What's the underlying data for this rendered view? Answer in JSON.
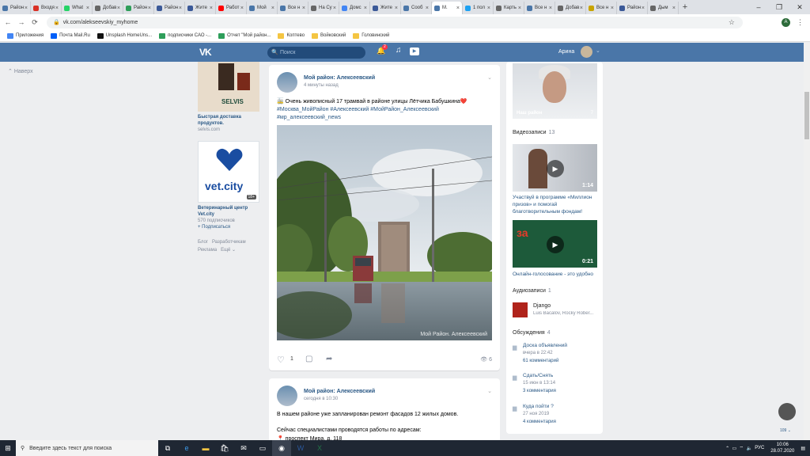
{
  "tabs": [
    {
      "label": "Район",
      "color": "#4a76a8"
    },
    {
      "label": "Входя",
      "color": "#d93025"
    },
    {
      "label": "What",
      "color": "#25d366"
    },
    {
      "label": "Добав",
      "color": "#666666"
    },
    {
      "label": "Район",
      "color": "#2e9e5a"
    },
    {
      "label": "Район",
      "color": "#3b5998"
    },
    {
      "label": "Жите",
      "color": "#3b5998"
    },
    {
      "label": "Работ",
      "color": "#ff0000"
    },
    {
      "label": "Мой",
      "color": "#4a76a8"
    },
    {
      "label": "Все н",
      "color": "#4a76a8"
    },
    {
      "label": "На Су",
      "color": "#666666"
    },
    {
      "label": "Домс",
      "color": "#4285f4"
    },
    {
      "label": "Жите",
      "color": "#3b5998"
    },
    {
      "label": "Сооб",
      "color": "#4a76a8"
    },
    {
      "label": "М.",
      "color": "#4a76a8",
      "active": true
    },
    {
      "label": "1 пол",
      "color": "#1da1f2"
    },
    {
      "label": "Карть",
      "color": "#666666"
    },
    {
      "label": "Все н",
      "color": "#4a76a8"
    },
    {
      "label": "Добав",
      "color": "#666666"
    },
    {
      "label": "Все н",
      "color": "#c8a400"
    },
    {
      "label": "Район",
      "color": "#3b5998"
    },
    {
      "label": "Дым",
      "color": "#666666"
    }
  ],
  "url": "vk.com/alekseevskiy_myhome",
  "profile_letter": "A",
  "bookmarks": [
    {
      "label": "Приложения",
      "color": "#4285f4"
    },
    {
      "label": "Почта Mail.Ru",
      "color": "#005ff9"
    },
    {
      "label": "Unsplash HomeUns...",
      "color": "#111111"
    },
    {
      "label": "подписчики САО -...",
      "color": "#2e9e5a"
    },
    {
      "label": "Отчет \"Мой район...",
      "color": "#2e9e5a"
    },
    {
      "label": "Коптево",
      "color": "#f4c542"
    },
    {
      "label": "Войковский",
      "color": "#f4c542"
    },
    {
      "label": "Головинский",
      "color": "#f4c542"
    }
  ],
  "vk": {
    "search_placeholder": "Поиск",
    "notif_count": "2",
    "user_name": "Арина"
  },
  "back_up": "Наверх",
  "left_ads": {
    "ad1_brand": "SELVIS",
    "ad1_title": "Быстрая доставка продуктов.",
    "ad1_site": "selvis.com",
    "ad2_brand": "vet.city",
    "ad2_age": "18+",
    "ad2_title": "Ветеринарный центр Vet.city",
    "ad2_subs": "570 подписчиков",
    "ad2_sub": "+ Подписаться",
    "footer_links": [
      "Блог",
      "Разработчикам",
      "Реклама",
      "Ещё"
    ]
  },
  "post1": {
    "author": "Мой район: Алексеевский",
    "time": "4 минуты назад",
    "text": "🚋 Очень живописный 17 трамвай в районе улицы Лётчика Бабушкина❤️",
    "tags": "#Москва_МойРайон #Алексеевский #МойРайон_Алексеевский #мр_алексеевский_news",
    "watermark": "Мой Район. Алексеевский",
    "likes": "1",
    "views": "6"
  },
  "post2": {
    "author": "Мой район: Алексеевский",
    "time": "сегодня в 10:30",
    "text1": "В нашем районе уже запланирован ремонт фасадов 12 жилых домов.",
    "text2": "Сейчас специалистами проводятся работы по адресам:",
    "text3": "📍 проспект Мира, д. 118"
  },
  "right": {
    "photo_label": "Наш район",
    "photo_count": "7",
    "videos_label": "Видеозаписи",
    "videos_count": "13",
    "video1_dur": "1:14",
    "video1_caption": "Участвуй в программе «Миллион призов» и помогай благотворительным фондам!",
    "video2_dur": "0:21",
    "video2_caption": "Онлайн-голосование - это удобно",
    "audio_label": "Аудиозаписи",
    "audio_count": "1",
    "audio_title": "Django",
    "audio_artist": "Luis Bacalov, Rocky Rober...",
    "disc_label": "Обсуждения",
    "disc_count": "4",
    "discussions": [
      {
        "title": "Доска объявлений",
        "date": "вчера в 22:42",
        "comments": "61 комментарий"
      },
      {
        "title": "Сдать/Снять",
        "date": "15 июн в 13:14",
        "comments": "3 комментария"
      },
      {
        "title": "Куда пойти ?",
        "date": "27 ноя 2019",
        "comments": "4 комментария"
      }
    ]
  },
  "chat_count": "109",
  "taskbar": {
    "search_placeholder": "Введите здесь текст для поиска",
    "lang": "РУС",
    "time": "10:06",
    "date": "28.07.2020"
  }
}
